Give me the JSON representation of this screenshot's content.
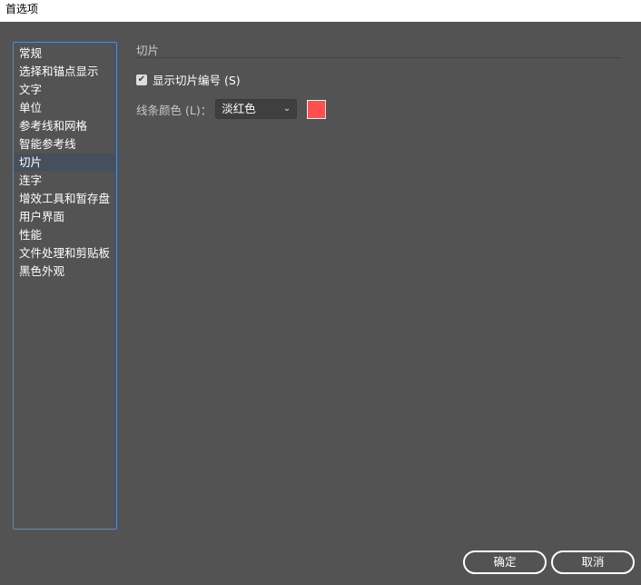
{
  "window": {
    "title": "首选项"
  },
  "sidebar": {
    "items": [
      {
        "label": "常规"
      },
      {
        "label": "选择和锚点显示"
      },
      {
        "label": "文字"
      },
      {
        "label": "单位"
      },
      {
        "label": "参考线和网格"
      },
      {
        "label": "智能参考线"
      },
      {
        "label": "切片",
        "selected": true
      },
      {
        "label": "连字"
      },
      {
        "label": "增效工具和暂存盘"
      },
      {
        "label": "用户界面"
      },
      {
        "label": "性能"
      },
      {
        "label": "文件处理和剪贴板"
      },
      {
        "label": "黑色外观"
      }
    ]
  },
  "panel": {
    "title": "切片",
    "show_slice_numbers": {
      "label": "显示切片编号 (S)",
      "checked": true
    },
    "line_color": {
      "label": "线条颜色 (L)：",
      "value": "淡红色",
      "swatch": "#ff4f4f"
    }
  },
  "buttons": {
    "ok": "确定",
    "cancel": "取消"
  }
}
